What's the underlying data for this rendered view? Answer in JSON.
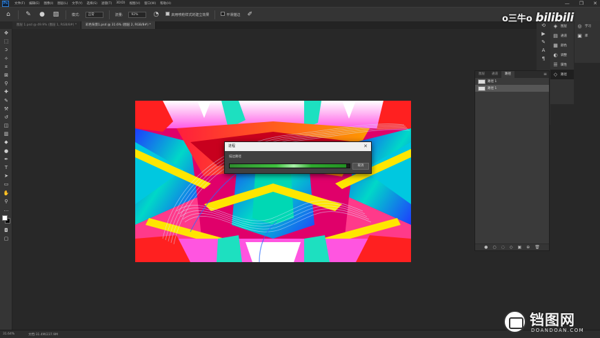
{
  "app": {
    "logo": "Ps",
    "menu": [
      "文件(F)",
      "编辑(E)",
      "图像(I)",
      "图层(L)",
      "文字(Y)",
      "选择(S)",
      "滤镜(T)",
      "3D(D)",
      "视图(V)",
      "窗口(W)",
      "帮助(H)"
    ],
    "window_controls": [
      "—",
      "❐",
      "✕"
    ]
  },
  "options_bar": {
    "mode_label": "模式:",
    "mode_value": "正常",
    "opacity_label": "流量:",
    "opacity_value": "92%",
    "check1_label": "启用喷枪样式的建立效果",
    "check2_label": "平滑描边"
  },
  "tabs": [
    {
      "label": "图层 1.psd @ 49.9% (图层 1, RGB/8#) *",
      "active": false
    },
    {
      "label": "彩色背景1.psd @ 31.6% (图层 2, RGB/8#) *",
      "active": true
    }
  ],
  "dialog": {
    "title": "进程",
    "close": "✕",
    "status": "描边路径",
    "progress": 0.97,
    "button": "取消"
  },
  "dock": {
    "col2": [
      {
        "icon": "layers-icon",
        "glyph": "◈",
        "label": "图层",
        "active": false
      },
      {
        "icon": "channels-icon",
        "glyph": "▤",
        "label": "通道",
        "active": false
      },
      {
        "icon": "swatches-icon",
        "glyph": "▦",
        "label": "颜色",
        "active": false
      },
      {
        "icon": "adjust-icon",
        "glyph": "◐",
        "label": "调整",
        "active": false
      },
      {
        "icon": "properties-icon",
        "glyph": "☰",
        "label": "属性",
        "active": false
      },
      {
        "icon": "paths-icon",
        "glyph": "◇",
        "label": "路径",
        "active": true
      }
    ],
    "col3": [
      {
        "icon": "learn-icon",
        "glyph": "◎",
        "label": "学习",
        "active": false
      },
      {
        "icon": "library-icon",
        "glyph": "▣",
        "label": "库",
        "active": false
      }
    ]
  },
  "panel": {
    "tabs": [
      {
        "label": "图层",
        "active": false
      },
      {
        "label": "通道",
        "active": false
      },
      {
        "label": "路径",
        "active": true
      }
    ],
    "menu": "≡",
    "paths": [
      {
        "label": "路径 1",
        "selected": false
      },
      {
        "label": "路径 1",
        "selected": true
      }
    ],
    "footer_icons": [
      "●",
      "○",
      "◌",
      "◇",
      "▣",
      "⊕",
      "🗑"
    ]
  },
  "status": {
    "zoom": "31.64%",
    "doc": "文档:31.4M/237.9M"
  },
  "watermark": {
    "bili_prefix": "o三牛o",
    "bili_logo": "bilibili",
    "site_cn": "铛图网",
    "site_en": "DOANDOAN.COM"
  }
}
